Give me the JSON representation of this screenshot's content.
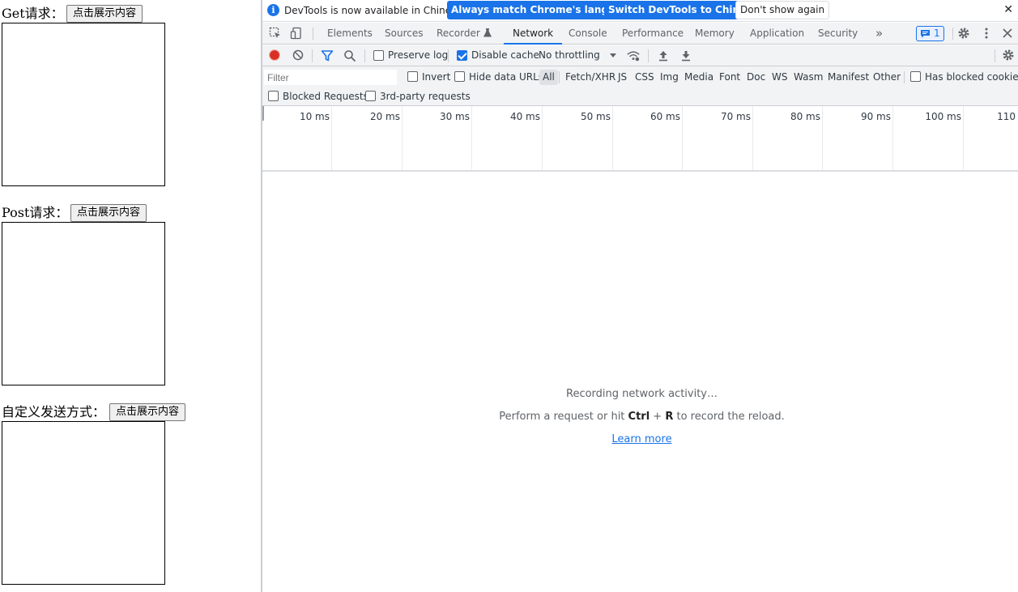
{
  "page": {
    "sections": [
      {
        "label": "Get请求：",
        "button": "点击展示内容"
      },
      {
        "label": "Post请求：",
        "button": "点击展示内容"
      },
      {
        "label": "自定义发送方式：",
        "button": "点击展示内容"
      }
    ]
  },
  "infobar": {
    "message": "DevTools is now available in Chinese!",
    "btn_match": "Always match Chrome's language",
    "btn_switch": "Switch DevTools to Chinese",
    "btn_dismiss": "Don't show again",
    "close": "✕"
  },
  "tabs": {
    "items": [
      "Elements",
      "Sources",
      "Recorder",
      "Network",
      "Console",
      "Performance",
      "Memory",
      "Application",
      "Security"
    ],
    "active": "Network",
    "more": "»",
    "issues_count": "1"
  },
  "toolbar": {
    "preserve_log": "Preserve log",
    "disable_cache": "Disable cache",
    "throttling": "No throttling"
  },
  "filterbar": {
    "filter_placeholder": "Filter",
    "invert": "Invert",
    "hide_data_urls": "Hide data URLs",
    "types": [
      "All",
      "Fetch/XHR",
      "JS",
      "CSS",
      "Img",
      "Media",
      "Font",
      "Doc",
      "WS",
      "Wasm",
      "Manifest",
      "Other"
    ],
    "has_blocked_cookies": "Has blocked cookies",
    "blocked_requests": "Blocked Requests",
    "third_party": "3rd-party requests"
  },
  "timeline": {
    "ticks": [
      "10 ms",
      "20 ms",
      "30 ms",
      "40 ms",
      "50 ms",
      "60 ms",
      "70 ms",
      "80 ms",
      "90 ms",
      "100 ms",
      "110"
    ]
  },
  "empty": {
    "recording": "Recording network activity…",
    "perform_prefix": "Perform a request or hit ",
    "key_ctrl": "Ctrl",
    "key_plus": " + ",
    "key_r": "R",
    "perform_suffix": " to record the reload.",
    "learn_more": "Learn more"
  },
  "colors": {
    "accent": "#1a73e8",
    "record": "#d93025",
    "toolbar_bg": "#f1f3f4"
  }
}
